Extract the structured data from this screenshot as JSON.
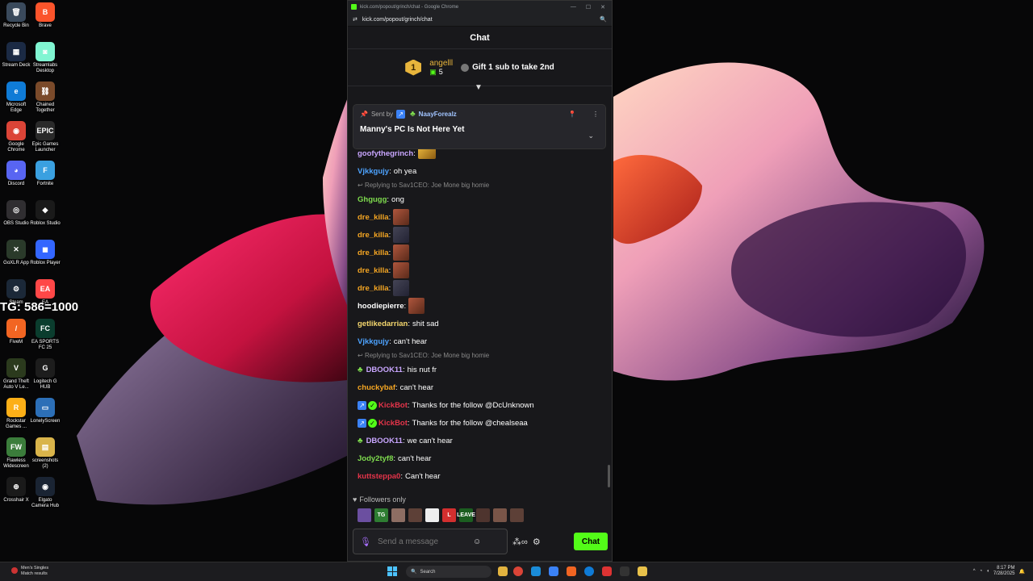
{
  "desktop": {
    "overlay_text": "TG: 586=1000",
    "icons": [
      {
        "label": "Recycle Bin",
        "glyph": "🗑",
        "color": "#3a4a5c"
      },
      {
        "label": "Brave",
        "glyph": "B",
        "color": "#fb542b"
      },
      {
        "label": "Stream Deck",
        "glyph": "▦",
        "color": "#1b2a44"
      },
      {
        "label": "Streamlabs Desktop",
        "glyph": "◙",
        "color": "#80f5d2"
      },
      {
        "label": "Microsoft Edge",
        "glyph": "e",
        "color": "#0f7bd6"
      },
      {
        "label": "Chained Together",
        "glyph": "⛓",
        "color": "#7a4a2a"
      },
      {
        "label": "Google Chrome",
        "glyph": "◉",
        "color": "#db4437"
      },
      {
        "label": "Epic Games Launcher",
        "glyph": "EPIC",
        "color": "#2a2a2a"
      },
      {
        "label": "Discord",
        "glyph": "◕",
        "color": "#5865f2"
      },
      {
        "label": "Fortnite",
        "glyph": "F",
        "color": "#3aa0e0"
      },
      {
        "label": "OBS Studio",
        "glyph": "◎",
        "color": "#302e31"
      },
      {
        "label": "Roblox Studio",
        "glyph": "◆",
        "color": "#1a1a1a"
      },
      {
        "label": "GoXLR App",
        "glyph": "✕",
        "color": "#2a3a2a"
      },
      {
        "label": "Roblox Player",
        "glyph": "◼",
        "color": "#3366ff"
      },
      {
        "label": "Steam",
        "glyph": "⚙",
        "color": "#1b2838"
      },
      {
        "label": "EA",
        "glyph": "EA",
        "color": "#ff4747"
      },
      {
        "label": "FiveM",
        "glyph": "/",
        "color": "#f26522"
      },
      {
        "label": "EA SPORTS FC 25",
        "glyph": "FC",
        "color": "#0b3d2e"
      },
      {
        "label": "Grand Theft Auto V Le...",
        "glyph": "V",
        "color": "#2b3a1d"
      },
      {
        "label": "Logitech G HUB",
        "glyph": "G",
        "color": "#1d1d1d"
      },
      {
        "label": "Rockstar Games ...",
        "glyph": "R",
        "color": "#fcaf17"
      },
      {
        "label": "LonelyScreen",
        "glyph": "▭",
        "color": "#2c6fb7"
      },
      {
        "label": "Flawless Widescreen",
        "glyph": "FW",
        "color": "#3b7d3b"
      },
      {
        "label": "screenshots (2)",
        "glyph": "▤",
        "color": "#d9b44a"
      },
      {
        "label": "Crosshair X",
        "glyph": "⊕",
        "color": "#1a1a1a"
      },
      {
        "label": "Elgato Camera Hub",
        "glyph": "◉",
        "color": "#1a2433"
      }
    ]
  },
  "browser": {
    "tab_title": "kick.com/popout/grinch/chat - Google Chrome",
    "url": "kick.com/popout/grinch/chat"
  },
  "chat": {
    "header": "Chat",
    "leaderboard": {
      "rank": "1",
      "name": "angelll",
      "count": "5",
      "gift_prompt": "Gift 1 sub to take 2nd"
    },
    "pinned": {
      "sent_by_label": "Sent by",
      "sender": "NaayForealz",
      "message": "Manny's PC Is Not Here Yet"
    },
    "messages": [
      {
        "user": "goofythegrinch",
        "color": "#c9a6ff",
        "text": "",
        "emote": "gold"
      },
      {
        "user": "Vjkkgujy",
        "color": "#4da3ff",
        "text": "oh yea"
      },
      {
        "reply": "Replying to Sav1CEO: Joe Mone big homie"
      },
      {
        "user": "Ghgugg",
        "color": "#7fdc4e",
        "text": "ong"
      },
      {
        "user": "dre_killa",
        "color": "#f5a623",
        "text": "",
        "emote": "face"
      },
      {
        "user": "dre_killa",
        "color": "#f5a623",
        "text": "",
        "emote": "dark"
      },
      {
        "user": "dre_killa",
        "color": "#f5a623",
        "text": "",
        "emote": "face"
      },
      {
        "user": "dre_killa",
        "color": "#f5a623",
        "text": "",
        "emote": "face"
      },
      {
        "user": "dre_killa",
        "color": "#f5a623",
        "text": "",
        "emote": "dark"
      },
      {
        "user": "hoodiepierre",
        "color": "#ffffff",
        "text": "",
        "emote": "face"
      },
      {
        "user": "getlikedarrian",
        "color": "#f5d76e",
        "text": "shit sad"
      },
      {
        "user": "Vjkkgujy",
        "color": "#4da3ff",
        "text": "can't hear"
      },
      {
        "reply": "Replying to Sav1CEO: Joe Mone big homie"
      },
      {
        "user": "DBOOK11",
        "color": "#c9a6ff",
        "text": "his nut fr",
        "sub": true
      },
      {
        "user": "chuckybaf",
        "color": "#f5a623",
        "text": "can't hear"
      },
      {
        "user": "KickBot",
        "color": "#e5344a",
        "text": "Thanks for the follow @DcUnknown",
        "bot": true
      },
      {
        "user": "KickBot",
        "color": "#e5344a",
        "text": "Thanks for the follow @chealseaa",
        "bot": true
      },
      {
        "user": "DBOOK11",
        "color": "#c9a6ff",
        "text": "we can't hear",
        "sub": true
      },
      {
        "user": "Jody2tyf8",
        "color": "#7fdc4e",
        "text": "can't hear"
      },
      {
        "user": "kuttsteppa0",
        "color": "#e5344a",
        "text": "Can't hear"
      }
    ],
    "followers_only": "Followers only",
    "input_placeholder": "Send a message",
    "send_label": "Chat",
    "emote_bar": [
      "",
      "TG",
      "",
      "",
      "",
      "L",
      "LEAVE",
      "",
      "",
      ""
    ]
  },
  "taskbar": {
    "news_title": "Men's Singles",
    "news_sub": "Match results",
    "search_placeholder": "Search",
    "time": "8:17 PM",
    "date": "7/28/2025"
  },
  "colors": {
    "kick_green": "#53fc18",
    "bg": "#18181b"
  }
}
